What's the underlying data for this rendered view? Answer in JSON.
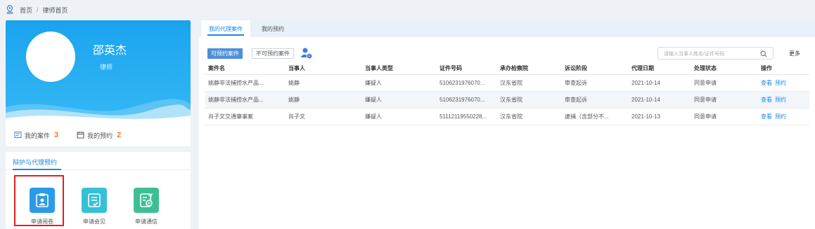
{
  "breadcrumb": {
    "home": "首页",
    "separator": "/",
    "current": "律师首页"
  },
  "profile": {
    "name": "邵英杰",
    "role": "律师",
    "stats": [
      {
        "label": "我的案件",
        "count": "3"
      },
      {
        "label": "我的预约",
        "count": "2"
      }
    ]
  },
  "apply": {
    "tab_label": "辩护与代理预约",
    "items": [
      {
        "label": "申请阅卷",
        "color": "#2b9be8"
      },
      {
        "label": "申请会见",
        "color": "#35c0d6"
      },
      {
        "label": "申请通信",
        "color": "#3dbf96"
      }
    ]
  },
  "main": {
    "tabs": [
      {
        "label": "我的代理案件"
      },
      {
        "label": "我的预约"
      }
    ],
    "filters": {
      "available": "可预约案件",
      "unavailable": "不可预约案件"
    },
    "search_placeholder": "请输入当事人姓名/证件号码",
    "more_label": "更多",
    "columns": [
      "案件名",
      "当事人",
      "当事人类型",
      "证件号码",
      "承办检察院",
      "诉讼阶段",
      "代理日期",
      "处理状态",
      "操作"
    ],
    "rows": [
      {
        "case": "姚静非法捕捞水产品...",
        "party": "姚静",
        "party_type": "嫌疑人",
        "id_no": "5106231976070...",
        "procuratorate": "汉东省院",
        "stage": "审查起诉",
        "date": "2021-10-14",
        "status": "同意申请",
        "view": "查看",
        "book": "预约"
      },
      {
        "case": "姚静非法捕捞水产品...",
        "party": "姚静",
        "party_type": "嫌疑人",
        "id_no": "5106231976070...",
        "procuratorate": "汉东省院",
        "stage": "审查起诉",
        "date": "2021-10-14",
        "status": "同意申请",
        "view": "查看",
        "book": "预约"
      },
      {
        "case": "肖子文交通肇事案",
        "party": "肖子文",
        "party_type": "嫌疑人",
        "id_no": "51112119550228...",
        "procuratorate": "汉东省院",
        "stage": "逮捕（含部分不...",
        "date": "2021-10-13",
        "status": "同意申请",
        "view": "查看",
        "book": "预约"
      }
    ]
  },
  "colors": {
    "accent": "#1e88e5",
    "banner": "#1aa3ee",
    "count": "#f07a1e",
    "highlight": "#e02020"
  }
}
